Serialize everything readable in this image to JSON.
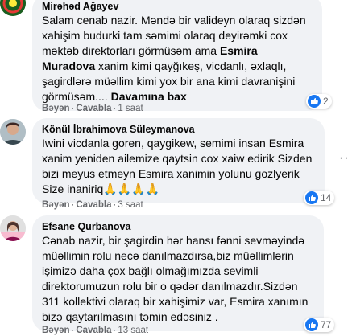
{
  "comments": [
    {
      "author": "Mirəhəd Ağayev",
      "text_before": "Salam cenab nazir. Məndə bir valideyn olaraq sizdən xahişim budurki tam səmimi olaraq deyirəmki cox məktəb direktorları görmüsəm ama ",
      "highlight": "Esmira Muradova",
      "text_after": " xanim kimi qayğıkeş, vicdanlı, əxlaqlı, şagirdlərə müəllim kimi yox bir ana kimi davranişini görmüsəm.... ",
      "more_label": "Davamına bax",
      "like_label": "Bəyən",
      "reply_label": "Cavabla",
      "time": "1 saat",
      "reactions": "2"
    },
    {
      "author": "Könül İbrahimova Süleymanova",
      "text": "Iwini vicdanla goren, qaygikew, semimi insan Esmira xanim yeniden ailemize qaytsin cox xaiw edirik Sizden bizi meyus etmeyn Esmira xanimin yolunu gozlyerik Size inaniriq🙏🙏🙏🙏",
      "like_label": "Bəyən",
      "reply_label": "Cavabla",
      "time": "3 saat",
      "reactions": "14"
    },
    {
      "author": "Efsane Qurbanova",
      "text": "Cənab nazir, bir şagirdin hər hansı fənni sevməyində müəllimin rolu necə danılmazdırsa,biz müəllimlərin işimizə daha çox bağlı olmağımızda sevimli direktorumuzun rolu bir o qədər danılmazdır.Sizdən 311 kollektivi olaraq bir xahişimiz var, Esmira xanımın bizə qaytarılmasını təmin edəsiniz .",
      "like_label": "Bəyən",
      "reply_label": "Cavabla",
      "time": "13 saat",
      "reactions": "77"
    }
  ],
  "separator": "·",
  "more_options": "··"
}
